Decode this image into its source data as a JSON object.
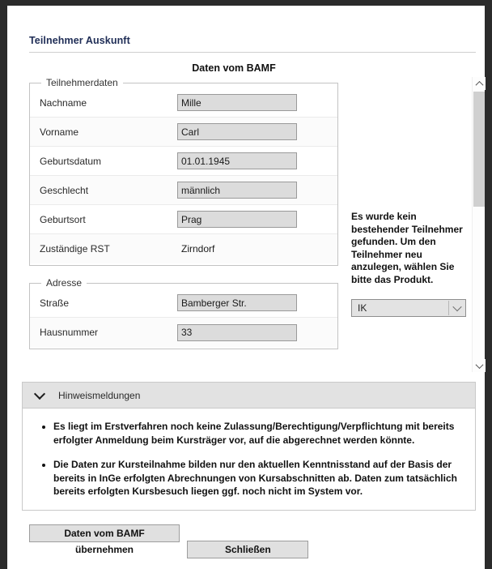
{
  "window": {
    "title": "Teilnehmer Auskunft",
    "section_heading": "Daten vom BAMF"
  },
  "form": {
    "groups": [
      {
        "legend": "Teilnehmerdaten",
        "rows": [
          {
            "label": "Nachname",
            "value": "Mille",
            "type": "input"
          },
          {
            "label": "Vorname",
            "value": "Carl",
            "type": "input"
          },
          {
            "label": "Geburtsdatum",
            "value": "01.01.1945",
            "type": "input"
          },
          {
            "label": "Geschlecht",
            "value": "männlich",
            "type": "input"
          },
          {
            "label": "Geburtsort",
            "value": "Prag",
            "type": "input"
          },
          {
            "label": "Zuständige RST",
            "value": "Zirndorf",
            "type": "text"
          }
        ]
      },
      {
        "legend": "Adresse",
        "rows": [
          {
            "label": "Straße",
            "value": "Bamberger Str.",
            "type": "input"
          },
          {
            "label": "Hausnummer",
            "value": "33",
            "type": "input"
          }
        ]
      }
    ]
  },
  "notice": {
    "message": "Es wurde kein bestehender Teilnehmer gefunden. Um den Teilnehmer neu anzulegen, wählen Sie bitte das Produkt.",
    "product_select": {
      "selected": "IK",
      "options": [
        "IK"
      ]
    }
  },
  "hints": {
    "title": "Hinweismeldungen",
    "expanded": true,
    "items": [
      "Es liegt im Erstverfahren noch keine Zulassung/Berechtigung/Verpflichtung mit bereits erfolgter Anmeldung beim Kursträger vor, auf die abgerechnet werden könnte.",
      "Die Daten zur Kursteilnahme bilden nur den aktuellen Kenntnisstand auf der Basis der bereits in InGe erfolgten Abrechnungen von Kursabschnitten ab. Daten zum tatsächlich bereits erfolgten Kursbesuch liegen ggf. noch nicht im System vor."
    ]
  },
  "footer": {
    "submit_label": "Daten vom BAMF übernehmen",
    "close_label": "Schließen"
  },
  "colors": {
    "title_navy": "#1f2d56",
    "panel_header_gray": "#e2e2e2",
    "input_fill": "#dcdcdc",
    "frame_dark": "#2b2b2b"
  }
}
